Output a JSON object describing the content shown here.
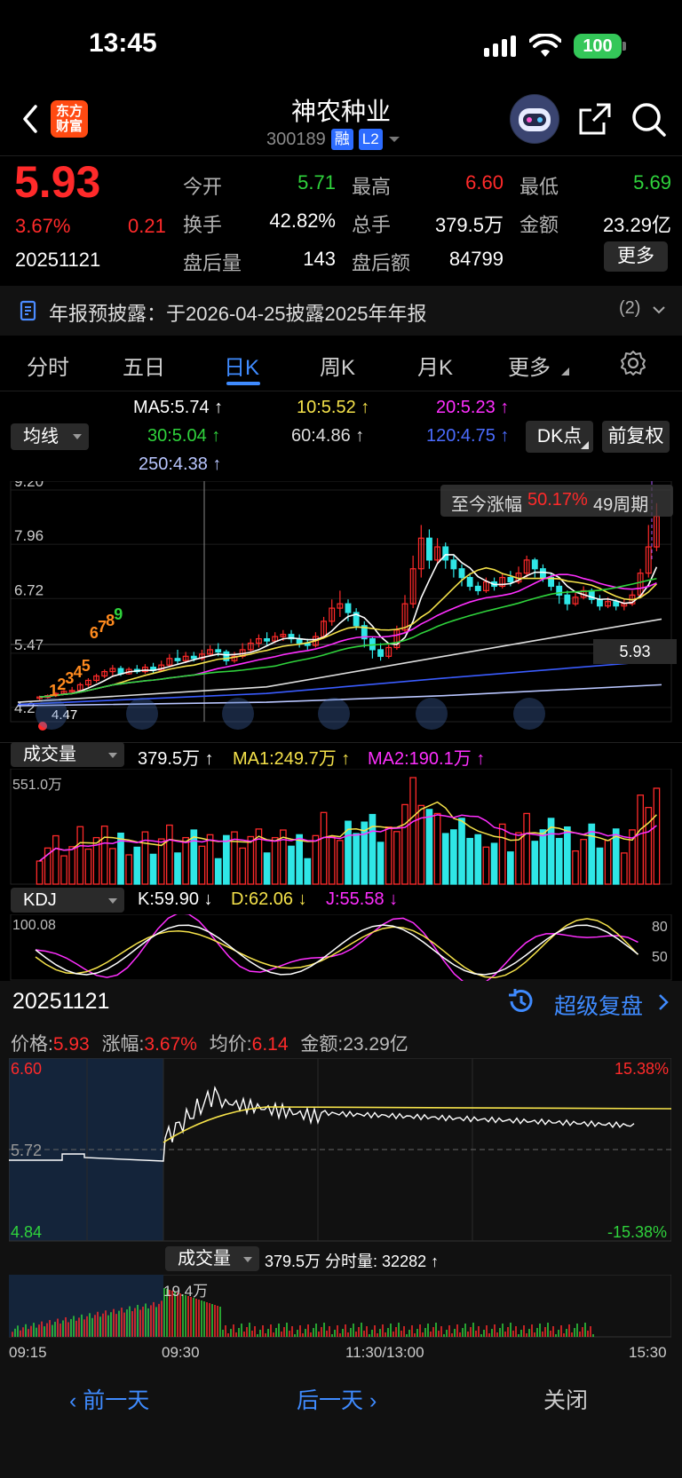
{
  "status": {
    "time": "13:45",
    "battery": "100"
  },
  "header": {
    "logo_text_1": "东方",
    "logo_text_2": "财富",
    "name": "神农种业",
    "code": "300189",
    "tag_rong": "融",
    "tag_l2": "L2"
  },
  "quote": {
    "price": "5.93",
    "change_pct": "3.67%",
    "change": "0.21",
    "date": "20251121",
    "fields": [
      {
        "label": "今开",
        "value": "5.71"
      },
      {
        "label": "最高",
        "value": "6.60"
      },
      {
        "label": "最低",
        "value": "5.69"
      },
      {
        "label": "换手",
        "value": "42.82%"
      },
      {
        "label": "总手",
        "value": "379.5万"
      },
      {
        "label": "金额",
        "value": "23.29亿"
      },
      {
        "label": "盘后量",
        "value": "143"
      },
      {
        "label": "盘后额",
        "value": "84799"
      }
    ],
    "more": "更多"
  },
  "notice": {
    "text": "年报预披露：于2026-04-25披露2025年年报",
    "count": "(2)"
  },
  "tabs": [
    "分时",
    "五日",
    "日K",
    "周K",
    "月K",
    "更多"
  ],
  "active_tab": "日K",
  "ma": {
    "selector": "均线",
    "ma5": "MA5:5.74 ↑",
    "ma10": "10:5.52 ↑",
    "ma20": "20:5.23 ↑",
    "ma30": "30:5.04 ↑",
    "ma60": "60:4.86 ↑",
    "ma120": "120:4.75 ↑",
    "ma250": "250:4.38 ↑",
    "dk_btn": "DK点",
    "fq_btn": "前复权"
  },
  "kchart": {
    "y_labels": [
      "9.20",
      "7.96",
      "6.72",
      "5.47",
      "4.2"
    ],
    "y_values": [
      9.2,
      7.96,
      6.72,
      5.47,
      4.23
    ],
    "badge_text": "至今涨幅",
    "badge_pct": "50.17%",
    "badge_period": "49周期",
    "current_price_tag": "5.93",
    "low_label": "4.47",
    "td_counts": [
      "1",
      "2",
      "3",
      "4",
      "5",
      "6",
      "7",
      "8",
      "9"
    ]
  },
  "chart_data": {
    "type": "candlestick",
    "y_range": [
      4.23,
      9.2
    ],
    "candles": [
      [
        4.45,
        4.47,
        4.4,
        4.5
      ],
      [
        4.46,
        4.5,
        4.43,
        4.53
      ],
      [
        4.5,
        4.55,
        4.47,
        4.58
      ],
      [
        4.55,
        4.6,
        4.52,
        4.63
      ],
      [
        4.6,
        4.62,
        4.55,
        4.7
      ],
      [
        4.62,
        4.75,
        4.6,
        4.8
      ],
      [
        4.75,
        4.85,
        4.7,
        4.9
      ],
      [
        4.85,
        4.95,
        4.8,
        5.0
      ],
      [
        4.95,
        5.05,
        4.9,
        5.1
      ],
      [
        5.05,
        5.12,
        4.95,
        5.2
      ],
      [
        5.12,
        5.0,
        4.95,
        5.18
      ],
      [
        5.0,
        5.1,
        4.98,
        5.15
      ],
      [
        5.1,
        5.05,
        5.0,
        5.2
      ],
      [
        5.05,
        5.15,
        5.0,
        5.22
      ],
      [
        5.15,
        5.08,
        5.0,
        5.25
      ],
      [
        5.08,
        5.2,
        5.05,
        5.3
      ],
      [
        5.2,
        5.35,
        5.15,
        5.45
      ],
      [
        5.35,
        5.3,
        5.2,
        5.55
      ],
      [
        5.3,
        5.4,
        5.25,
        5.5
      ],
      [
        5.4,
        5.35,
        5.28,
        5.5
      ],
      [
        5.35,
        5.45,
        5.3,
        5.55
      ],
      [
        5.45,
        5.55,
        5.4,
        5.65
      ],
      [
        5.55,
        5.5,
        5.4,
        5.7
      ],
      [
        5.5,
        5.3,
        5.2,
        5.55
      ],
      [
        5.3,
        5.4,
        5.25,
        5.5
      ],
      [
        5.4,
        5.55,
        5.35,
        5.7
      ],
      [
        5.55,
        5.7,
        5.5,
        5.8
      ],
      [
        5.7,
        5.8,
        5.6,
        5.9
      ],
      [
        5.8,
        5.75,
        5.65,
        5.95
      ],
      [
        5.75,
        5.85,
        5.7,
        5.95
      ],
      [
        5.85,
        5.9,
        5.75,
        6.0
      ],
      [
        5.9,
        5.8,
        5.7,
        6.0
      ],
      [
        5.8,
        5.7,
        5.6,
        5.9
      ],
      [
        5.7,
        5.65,
        5.55,
        5.8
      ],
      [
        5.65,
        5.85,
        5.6,
        5.95
      ],
      [
        5.85,
        6.2,
        5.8,
        6.3
      ],
      [
        6.2,
        6.5,
        6.1,
        6.7
      ],
      [
        6.5,
        6.6,
        6.3,
        6.9
      ],
      [
        6.6,
        6.4,
        6.2,
        6.7
      ],
      [
        6.4,
        6.1,
        6.0,
        6.5
      ],
      [
        6.1,
        5.8,
        5.6,
        6.2
      ],
      [
        5.8,
        5.55,
        5.35,
        5.85
      ],
      [
        5.55,
        5.4,
        5.3,
        5.7
      ],
      [
        5.4,
        5.6,
        5.35,
        5.7
      ],
      [
        5.6,
        6.0,
        5.55,
        6.1
      ],
      [
        6.0,
        6.6,
        5.95,
        6.8
      ],
      [
        6.6,
        7.4,
        6.5,
        7.7
      ],
      [
        7.4,
        8.1,
        7.2,
        8.4
      ],
      [
        8.1,
        7.6,
        7.4,
        8.3
      ],
      [
        7.6,
        7.9,
        7.5,
        8.1
      ],
      [
        7.9,
        7.6,
        7.4,
        8.0
      ],
      [
        7.6,
        7.4,
        7.2,
        7.7
      ],
      [
        7.4,
        7.2,
        7.0,
        7.5
      ],
      [
        7.2,
        7.0,
        6.9,
        7.3
      ],
      [
        7.0,
        6.9,
        6.8,
        7.1
      ],
      [
        6.9,
        7.1,
        6.85,
        7.2
      ],
      [
        7.1,
        7.0,
        6.9,
        7.2
      ],
      [
        7.0,
        7.2,
        6.95,
        7.3
      ],
      [
        7.2,
        7.1,
        7.0,
        7.35
      ],
      [
        7.1,
        7.3,
        7.05,
        7.45
      ],
      [
        7.3,
        7.6,
        7.2,
        7.7
      ],
      [
        7.6,
        7.4,
        7.2,
        7.65
      ],
      [
        7.4,
        7.2,
        7.1,
        7.5
      ],
      [
        7.2,
        7.0,
        6.9,
        7.3
      ],
      [
        7.0,
        6.8,
        6.6,
        7.1
      ],
      [
        6.8,
        6.6,
        6.45,
        6.9
      ],
      [
        6.6,
        6.75,
        6.55,
        6.85
      ],
      [
        6.75,
        6.9,
        6.7,
        7.0
      ],
      [
        6.9,
        6.7,
        6.6,
        6.95
      ],
      [
        6.7,
        6.55,
        6.45,
        6.8
      ],
      [
        6.55,
        6.65,
        6.5,
        6.75
      ],
      [
        6.65,
        6.55,
        6.45,
        6.7
      ],
      [
        6.55,
        6.6,
        6.45,
        6.7
      ],
      [
        6.6,
        6.8,
        6.55,
        6.9
      ],
      [
        6.8,
        7.3,
        6.75,
        7.4
      ],
      [
        7.3,
        7.9,
        7.2,
        8.4
      ],
      [
        7.9,
        8.6,
        7.8,
        8.9
      ]
    ],
    "volume": {
      "max_label": "551.0万"
    }
  },
  "volume": {
    "selector": "成交量",
    "value": "379.5万 ↑",
    "ma1": "MA1:249.7万 ↑",
    "ma2": "MA2:190.1万 ↑",
    "max": "551.0万"
  },
  "kdj": {
    "selector": "KDJ",
    "k": "K:59.90 ↓",
    "d": "D:62.06 ↓",
    "j": "J:55.58 ↓",
    "top": "100.08",
    "r80": "80",
    "r50": "50"
  },
  "detail": {
    "date": "20251121",
    "replay": "超级复盘",
    "price_label": "价格:",
    "price": "5.93",
    "pct_label": "涨幅:",
    "pct": "3.67%",
    "avg_label": "均价:",
    "avg": "6.14",
    "amount_label": "金额:23.29亿",
    "high": "6.60",
    "mid": "5.72",
    "low": "4.84",
    "high_pct": "15.38%",
    "low_pct": "-15.38%",
    "vol_selector": "成交量",
    "vol_text": "379.5万 分时量: 32282 ↑",
    "vol_max": "19.4万",
    "times": [
      "09:15",
      "09:30",
      "11:30/13:00",
      "15:30"
    ]
  },
  "footer": {
    "prev": "前一天",
    "next": "后一天",
    "close": "关闭"
  },
  "colors": {
    "up": "#ff2a2a",
    "down": "#2fd33c",
    "accent": "#3f8bff"
  }
}
